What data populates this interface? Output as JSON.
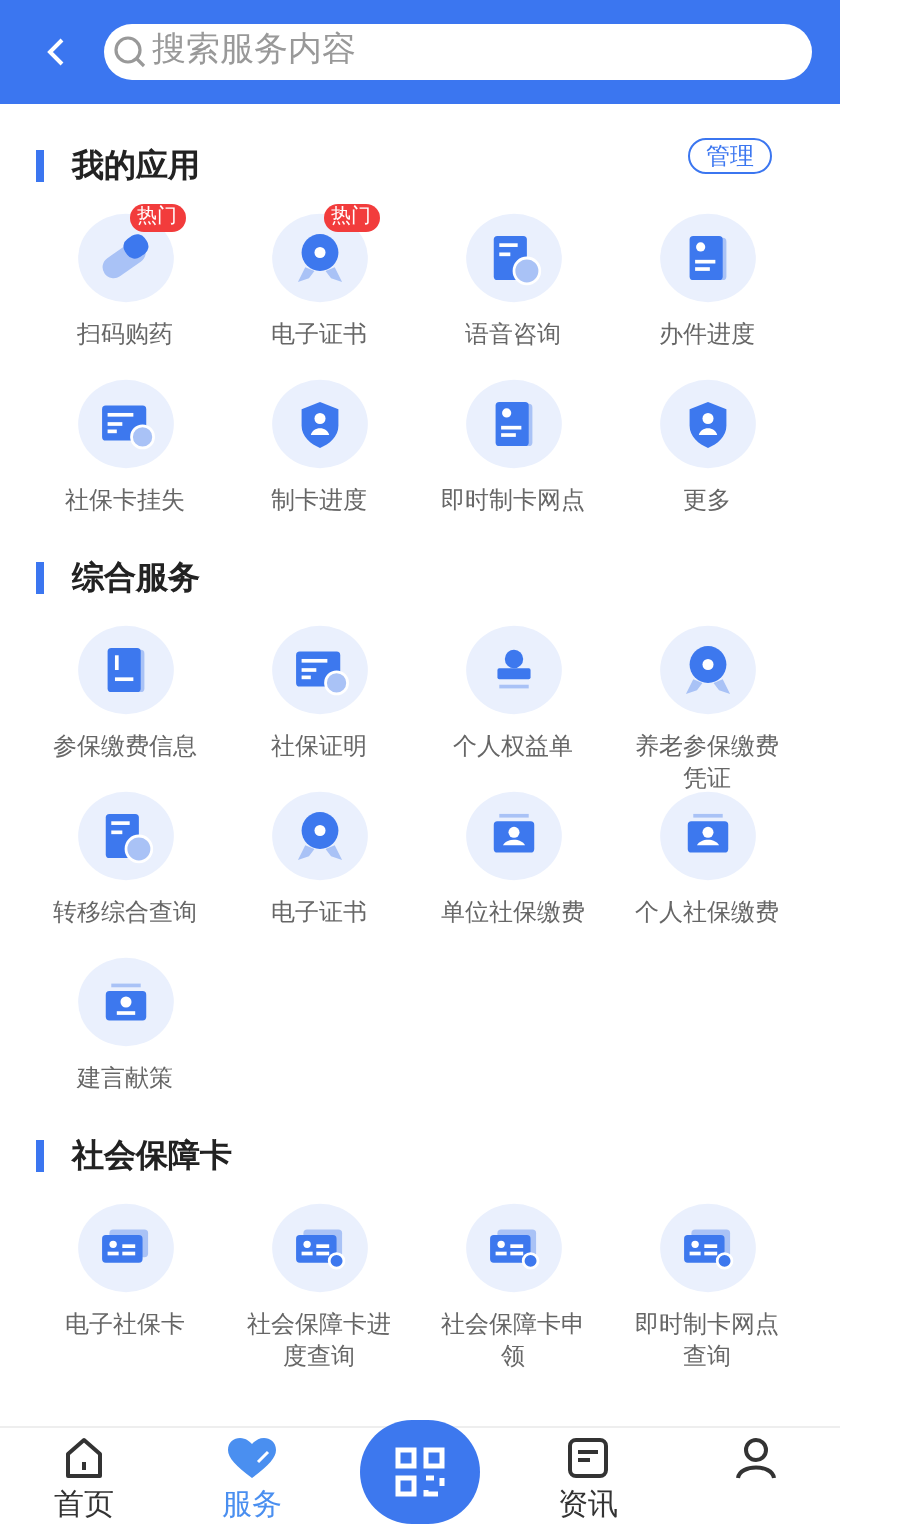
{
  "header": {
    "search": {
      "placeholder": "搜索服务内容"
    }
  },
  "sections": [
    {
      "title": "我的应用",
      "action": "管理",
      "items": [
        {
          "label": "扫码购药",
          "kind": "pill",
          "badge": "热门"
        },
        {
          "label": "电子证书",
          "kind": "medal",
          "badge": "热门"
        },
        {
          "label": "语音咨询",
          "kind": "report"
        },
        {
          "label": "办件进度",
          "kind": "book"
        },
        {
          "label": "社保卡挂失",
          "kind": "form"
        },
        {
          "label": "制卡进度",
          "kind": "shield"
        },
        {
          "label": "即时制卡网点",
          "kind": "book"
        },
        {
          "label": "更多",
          "kind": "shield"
        }
      ]
    },
    {
      "title": "综合服务",
      "items": [
        {
          "label": "参保缴费信息",
          "kind": "ledger"
        },
        {
          "label": "社保证明",
          "kind": "form"
        },
        {
          "label": "个人权益单",
          "kind": "stamp"
        },
        {
          "label": "养老参保缴费凭证",
          "kind": "medal"
        },
        {
          "label": "转移综合查询",
          "kind": "report"
        },
        {
          "label": "电子证书",
          "kind": "medal"
        },
        {
          "label": "单位社保缴费",
          "kind": "wallet"
        },
        {
          "label": "个人社保缴费",
          "kind": "wallet"
        },
        {
          "label": "建言献策",
          "kind": "folder"
        }
      ]
    },
    {
      "title": "社会保障卡",
      "items": [
        {
          "label": "电子社保卡",
          "kind": "idcard"
        },
        {
          "label": "社会保障卡进度查询",
          "kind": "idcard-gear"
        },
        {
          "label": "社会保障卡申领",
          "kind": "idcard-gear"
        },
        {
          "label": "即时制卡网点查询",
          "kind": "idcard-gear"
        }
      ]
    }
  ],
  "tabbar": [
    {
      "label": "首页",
      "kind": "home",
      "selected": false
    },
    {
      "label": "服务",
      "kind": "heart",
      "selected": true
    },
    {
      "kind": "scan",
      "selected": false
    },
    {
      "label": "资讯",
      "kind": "news",
      "selected": false
    },
    {
      "kind": "person",
      "selected": false
    }
  ]
}
